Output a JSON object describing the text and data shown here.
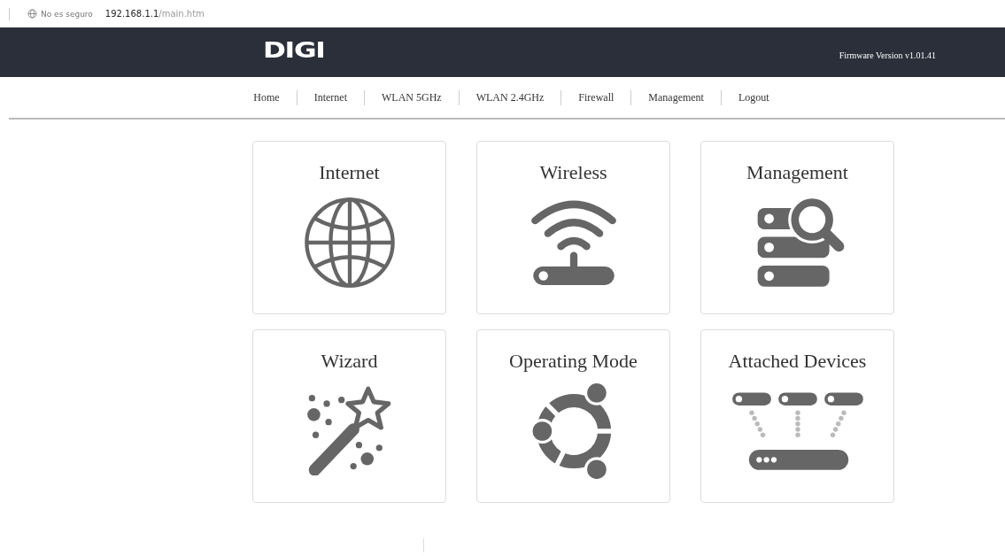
{
  "address_bar": {
    "security": "No es seguro",
    "host": "192.168.1.1",
    "path": "/main.htm"
  },
  "header": {
    "logo": "DIGI",
    "firmware": "Firmware Version v1.01.41"
  },
  "nav": [
    "Home",
    "Internet",
    "WLAN 5GHz",
    "WLAN 2.4GHz",
    "Firewall",
    "Management",
    "Logout"
  ],
  "cards": [
    {
      "title": "Internet",
      "kind": "globe"
    },
    {
      "title": "Wireless",
      "kind": "router"
    },
    {
      "title": "Management",
      "kind": "servers"
    },
    {
      "title": "Wizard",
      "kind": "wand"
    },
    {
      "title": "Operating Mode",
      "kind": "circle"
    },
    {
      "title": "Attached Devices",
      "kind": "devices"
    }
  ]
}
